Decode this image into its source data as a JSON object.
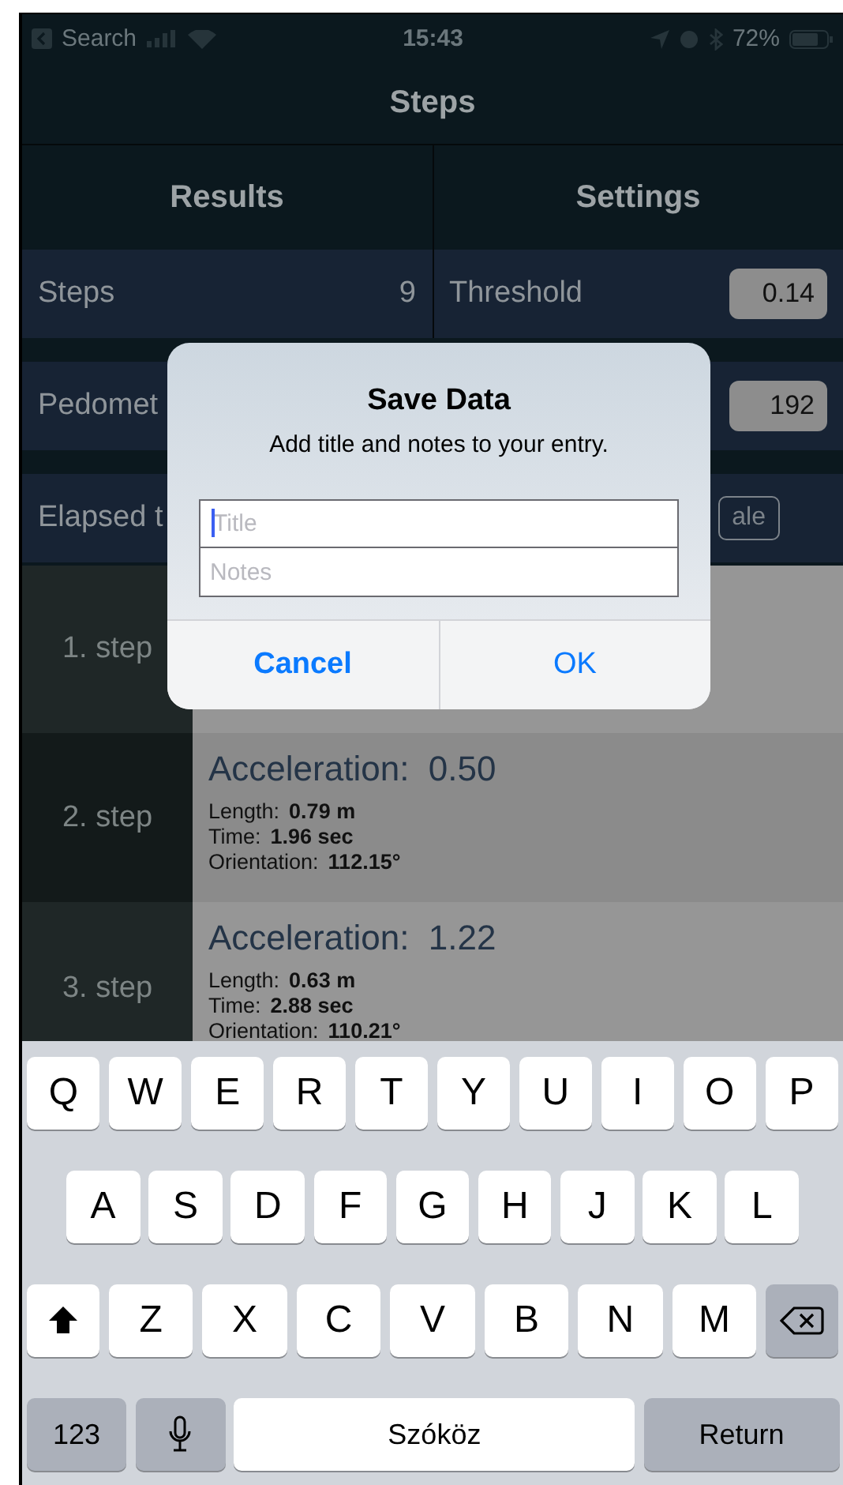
{
  "status_bar": {
    "back_label": "Search",
    "time": "15:43",
    "battery": "72%"
  },
  "nav_title": "Steps",
  "columns": [
    "Results",
    "Settings"
  ],
  "rows": [
    {
      "left_label": "Steps",
      "left_value": "9",
      "right_label": "Threshold",
      "right_value": "0.14",
      "right_is_button": false
    },
    {
      "left_label": "Pedomet",
      "right_value": "192",
      "right_is_button": false
    },
    {
      "left_label": "Elapsed t",
      "right_value": "ale",
      "right_is_button": true
    }
  ],
  "steps": [
    {
      "label": "1. step"
    },
    {
      "label": "2. step",
      "acceleration_label": "Acceleration:",
      "acceleration": "0.50",
      "details": [
        {
          "label": "Length:",
          "value": "0.79 m"
        },
        {
          "label": "Time:",
          "value": "1.96 sec"
        },
        {
          "label": "Orientation:",
          "value": "112.15°"
        }
      ]
    },
    {
      "label": "3. step",
      "acceleration_label": "Acceleration:",
      "acceleration": "1.22",
      "details": [
        {
          "label": "Length:",
          "value": "0.63 m"
        },
        {
          "label": "Time:",
          "value": "2.88 sec"
        },
        {
          "label": "Orientation:",
          "value": "110.21°"
        }
      ]
    }
  ],
  "dialog": {
    "title": "Save Data",
    "message": "Add title and notes to your entry.",
    "fields": [
      {
        "placeholder": "Title",
        "focused": true
      },
      {
        "placeholder": "Notes",
        "focused": false
      }
    ],
    "buttons": [
      {
        "label": "Cancel",
        "kind": "cancel"
      },
      {
        "label": "OK",
        "kind": "default"
      }
    ]
  },
  "keyboard": [
    [
      {
        "kind": "letter",
        "label": "Q"
      },
      {
        "kind": "letter",
        "label": "W"
      },
      {
        "kind": "letter",
        "label": "E"
      },
      {
        "kind": "letter",
        "label": "R"
      },
      {
        "kind": "letter",
        "label": "T"
      },
      {
        "kind": "letter",
        "label": "Y"
      },
      {
        "kind": "letter",
        "label": "U"
      },
      {
        "kind": "letter",
        "label": "I"
      },
      {
        "kind": "letter",
        "label": "O"
      },
      {
        "kind": "letter",
        "label": "P"
      }
    ],
    [
      {
        "kind": "letter",
        "label": "A"
      },
      {
        "kind": "letter",
        "label": "S"
      },
      {
        "kind": "letter",
        "label": "D"
      },
      {
        "kind": "letter",
        "label": "F"
      },
      {
        "kind": "letter",
        "label": "G"
      },
      {
        "kind": "letter",
        "label": "H"
      },
      {
        "kind": "letter",
        "label": "J"
      },
      {
        "kind": "letter",
        "label": "K"
      },
      {
        "kind": "letter",
        "label": "L"
      }
    ],
    [
      {
        "kind": "shift"
      },
      {
        "kind": "letter",
        "label": "Z"
      },
      {
        "kind": "letter",
        "label": "X"
      },
      {
        "kind": "letter",
        "label": "C"
      },
      {
        "kind": "letter",
        "label": "V"
      },
      {
        "kind": "letter",
        "label": "B"
      },
      {
        "kind": "letter",
        "label": "N"
      },
      {
        "kind": "letter",
        "label": "M"
      },
      {
        "kind": "backspace"
      }
    ],
    [
      {
        "kind": "numbers",
        "label": "123"
      },
      {
        "kind": "mic"
      },
      {
        "kind": "space",
        "label": "Szóköz"
      },
      {
        "kind": "return",
        "label": "Return"
      }
    ]
  ]
}
